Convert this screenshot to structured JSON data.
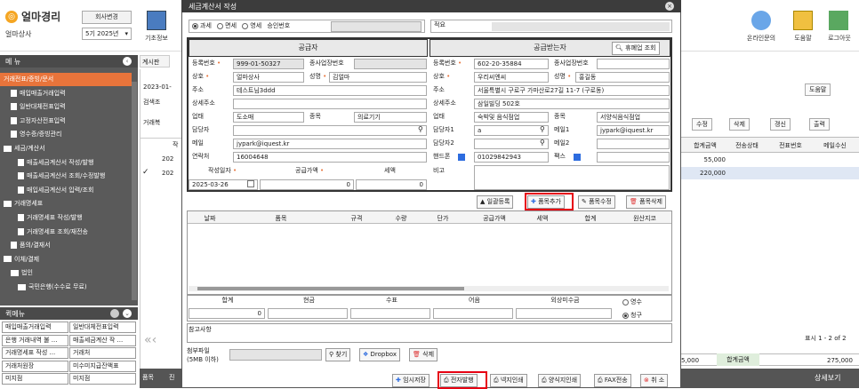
{
  "topbar": {
    "logo": "얼마경리",
    "company": "얼마상사",
    "change_company": "회사변경",
    "period": "5기 2025년",
    "basic_info": "기초정보",
    "online": "온라인문의",
    "help": "도움말",
    "logout": "로그아웃"
  },
  "sidebar": {
    "title": "메 뉴",
    "items": [
      {
        "label": "거래전표/증빙/문서",
        "type": "section",
        "active": true
      },
      {
        "label": "매입매출거래입력",
        "type": "doc"
      },
      {
        "label": "일반대체전표입력",
        "type": "doc"
      },
      {
        "label": "고정자산전표입력",
        "type": "doc"
      },
      {
        "label": "영수증/증빙관리",
        "type": "doc"
      },
      {
        "label": "세금/계산서",
        "type": "folder"
      },
      {
        "label": "매출세금계산서 작성/발행",
        "type": "doc2"
      },
      {
        "label": "매출세금계산서 조회/수정발행",
        "type": "doc2"
      },
      {
        "label": "매입세금계산서 입력/조회",
        "type": "doc2"
      },
      {
        "label": "거래명세표",
        "type": "folder"
      },
      {
        "label": "거래명세표 작성/발행",
        "type": "doc2"
      },
      {
        "label": "거래명세표 조회/재전송",
        "type": "doc2"
      },
      {
        "label": "품의/결재서",
        "type": "doc"
      },
      {
        "label": "이체/결제",
        "type": "folder"
      },
      {
        "label": "법인",
        "type": "folder2"
      },
      {
        "label": "국민은행(수수료 무료)",
        "type": "folder3"
      }
    ]
  },
  "quick": {
    "title": "퀵메뉴",
    "cells": [
      "매입매출거래입력",
      "일반대체전표입력",
      "은행 거래내역 불 ...",
      "매출세금계산 작 ...",
      "거래명세표 작성 ...",
      "거래처",
      "거래처원장",
      "미수미지급잔액표",
      "미지점",
      "미지점"
    ]
  },
  "background": {
    "tab": "계시판",
    "date": "2023-01-",
    "search": "검색조",
    "add": "거래복",
    "toolbar": [
      "수정",
      "삭제",
      "갱신",
      "출력"
    ],
    "help": "도움말",
    "columns": [
      "합계금액",
      "전송상태",
      "전표번호",
      "메일수신"
    ],
    "rows": [
      {
        "year": "202",
        "amount": "55,000"
      },
      {
        "year": "202",
        "amount": "220,000"
      }
    ],
    "row_check": "✓",
    "col_seq": "작",
    "pager": "표시 1 - 2 of 2",
    "sum_left": "5,000",
    "sum_label": "합계금액",
    "sum_value": "275,000",
    "detail": "상세보기",
    "foot_tabs": [
      "품목",
      "진"
    ]
  },
  "dialog": {
    "title": "세금계산서 작성",
    "tax_types": [
      "과세",
      "면세",
      "영세"
    ],
    "approval_label": "승인번호",
    "purpose_label": "적요",
    "supplier": {
      "header": "공급자",
      "reg_label": "등록번호",
      "reg": "999-01-50327",
      "branch_label": "종사업장번호",
      "name_label": "상호",
      "name": "얼마상사",
      "ceo_label": "성명",
      "ceo": "김얼마",
      "addr_label": "주소",
      "addr": "테스트님3ddd",
      "addr2_label": "상세주소",
      "biz_label": "업태",
      "biz": "도소매",
      "item_label": "종목",
      "item": "의료기기",
      "manager_label": "담당자",
      "email_label": "메일",
      "email": "jypark@iquest.kr",
      "phone_label": "연락처",
      "phone": "16004648"
    },
    "receiver": {
      "header": "공급받는자",
      "closed_btn": "휴폐업 조회",
      "reg_label": "등록번호",
      "reg": "602-20-35884",
      "branch_label": "종사업장번호",
      "name_label": "상호",
      "name": "우리씨엔씨",
      "ceo_label": "성명",
      "ceo": "홍길동",
      "addr_label": "주소",
      "addr": "서울특별시 구로구 가마산로27길 11-7 (구로동)",
      "addr2_label": "상세주소",
      "addr2": "삼일빌딩 502호",
      "biz_label": "업태",
      "biz": "숙박및 음식점업",
      "item_label": "종목",
      "item": "서양식음식점업",
      "m1_label": "담당자1",
      "m1": "a",
      "mail1_label": "메일1",
      "mail1": "jypark@iquest.kr",
      "m2_label": "담당자2",
      "mail2_label": "메일2",
      "cell_label": "핸드폰",
      "cell": "01029842943",
      "fax_label": "팩스",
      "note_label": "비고"
    },
    "date_label": "작성일자",
    "date": "2025-03-26",
    "supply_label": "공급가액",
    "supply": "0",
    "tax_label": "세액",
    "tax": "0",
    "item_btns": [
      "일괄등록",
      "품목추가",
      "품목수정",
      "품목삭제"
    ],
    "item_cols": [
      "날짜",
      "품목",
      "규격",
      "수량",
      "단가",
      "공급가액",
      "세액",
      "합계",
      "원산지코"
    ],
    "total_cols": [
      "합계",
      "현금",
      "수표",
      "어음",
      "외상미수금"
    ],
    "total": "0",
    "receipt": [
      "영수",
      "청구"
    ],
    "ref_label": "참고사항",
    "attach_label": "첨부파일",
    "attach_note": "(5MB 이하)",
    "find": "찾기",
    "dropbox": "Dropbox",
    "delete": "삭제",
    "bottom_btns": [
      "임시저장",
      "전자발행",
      "넥지인쇄",
      "양식지인쇄",
      "FAX전송",
      "취 소"
    ]
  }
}
